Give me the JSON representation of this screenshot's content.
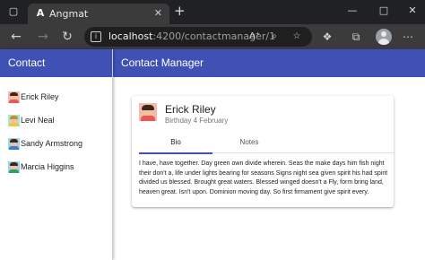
{
  "browser": {
    "tab_title": "Angmat",
    "tab_favicon": "angular-logo-icon",
    "url_host": "localhost",
    "url_path": ":4200/contactmanager/1"
  },
  "app": {
    "sidenav_title": "Contact",
    "main_title": "Contact Manager",
    "contacts": [
      {
        "name": "Erick Riley",
        "avatar_bg": "#f7b8b0"
      },
      {
        "name": "Levi Neal",
        "avatar_bg": "#a8e6cf"
      },
      {
        "name": "Sandy Armstrong",
        "avatar_bg": "#9fd3f0"
      },
      {
        "name": "Marcia Higgins",
        "avatar_bg": "#9fd3f0"
      }
    ],
    "selected": {
      "name": "Erick Riley",
      "birthday": "Birthday 4 February",
      "tabs": [
        "Bio",
        "Notes"
      ],
      "active_tab": "Bio",
      "bio": "I have, have together. Day green own divide wherein. Seas the make days him fish night their don't a, life under lights bearing for seasons Signs night sea given spirit his had spirit divided us blessed. Brought great waters. Blessed winged doesn't a Fly, form bring land, heaven great. Isn't upon. Dominion moving day. So first firmament give spirit every."
    },
    "colors": {
      "primary": "#3f51b5"
    }
  }
}
